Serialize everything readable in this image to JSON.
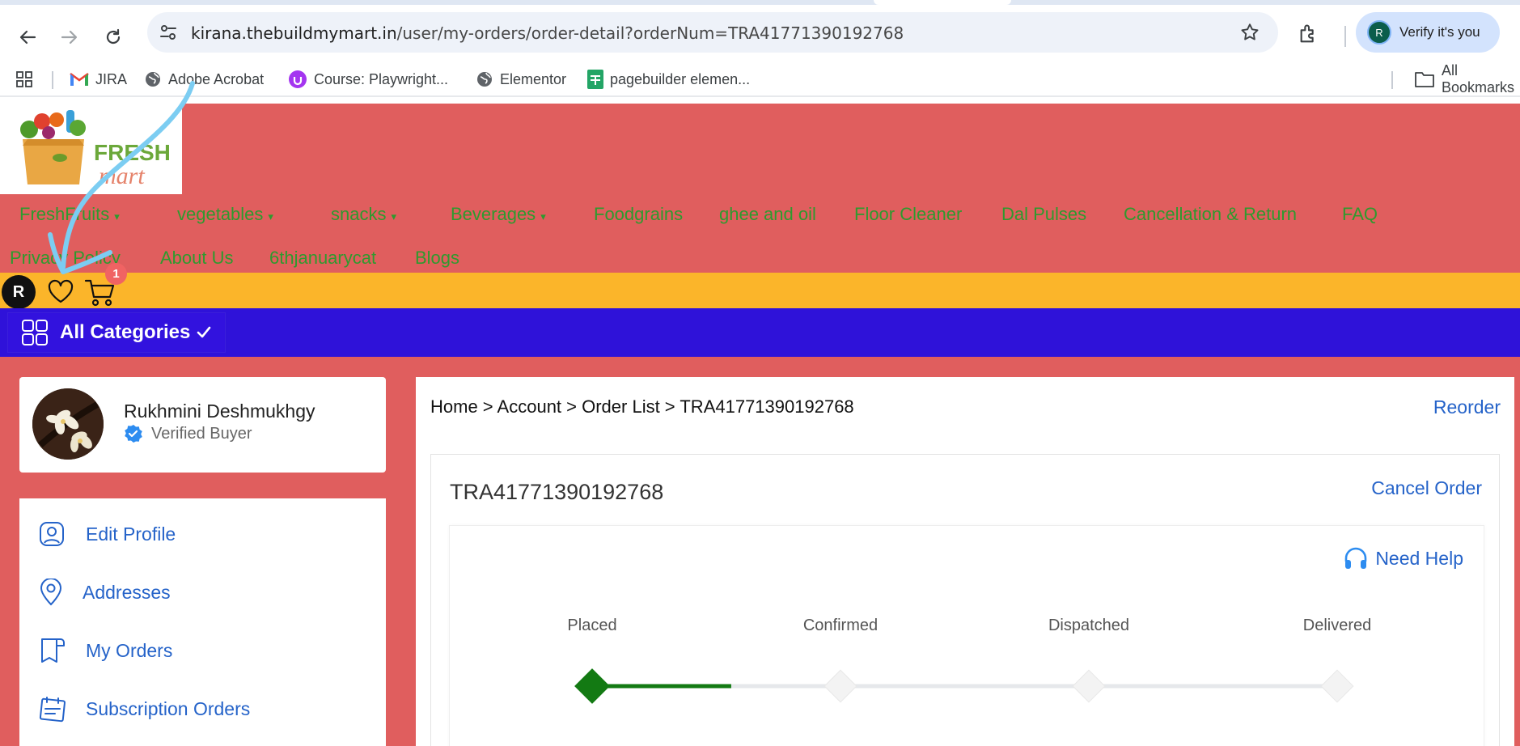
{
  "browser": {
    "url_host": "kirana.thebuildmymart.in",
    "url_path": "/user/my-orders/order-detail?orderNum=TRA41771390192768",
    "verify_label": "Verify it's you",
    "profile_initial": "R",
    "bookmarks": [
      {
        "label": "JIRA",
        "icon": "gmail-icon"
      },
      {
        "label": "Adobe Acrobat",
        "icon": "globe-icon"
      },
      {
        "label": "Course: Playwright...",
        "icon": "udemy-icon"
      },
      {
        "label": "Elementor",
        "icon": "globe-icon"
      },
      {
        "label": "pagebuilder elemen...",
        "icon": "sheets-icon"
      }
    ],
    "all_bookmarks": "All Bookmarks"
  },
  "site": {
    "logo_text_1": "FRESH",
    "logo_text_2": "mart",
    "menu": [
      {
        "label": "FreshFruits",
        "caret": "▾"
      },
      {
        "label": "vegetables",
        "caret": "▾"
      },
      {
        "label": "snacks",
        "caret": "▾"
      },
      {
        "label": "Beverages",
        "caret": "▾"
      },
      {
        "label": "Foodgrains"
      },
      {
        "label": "ghee and oil"
      },
      {
        "label": "Floor Cleaner"
      },
      {
        "label": "Dal Pulses"
      },
      {
        "label": "Cancellation & Return"
      },
      {
        "label": "FAQ"
      },
      {
        "label": "Privacy Policy"
      },
      {
        "label": "About Us"
      },
      {
        "label": "6thjanuarycat"
      },
      {
        "label": "Blogs"
      }
    ],
    "user_initial": "R",
    "cart_count": "1",
    "all_categories": "All Categories"
  },
  "profile": {
    "name": "Rukhmini Deshmukhgy",
    "status": "Verified Buyer"
  },
  "sidebar": {
    "items": [
      {
        "label": "Edit Profile",
        "icon": "user-icon"
      },
      {
        "label": "Addresses",
        "icon": "location-pin-icon"
      },
      {
        "label": "My Orders",
        "icon": "orders-icon"
      },
      {
        "label": "Subscription Orders",
        "icon": "calendar-icon"
      }
    ]
  },
  "order": {
    "breadcrumb": "Home > Account > Order List > TRA41771390192768",
    "reorder": "Reorder",
    "order_number": "TRA41771390192768",
    "cancel": "Cancel Order",
    "need_help": "Need Help",
    "steps": [
      "Placed",
      "Confirmed",
      "Dispatched",
      "Delivered"
    ],
    "current_step": 1,
    "colors": {
      "done": "#137a13",
      "pending": "#e6e8eb"
    }
  }
}
